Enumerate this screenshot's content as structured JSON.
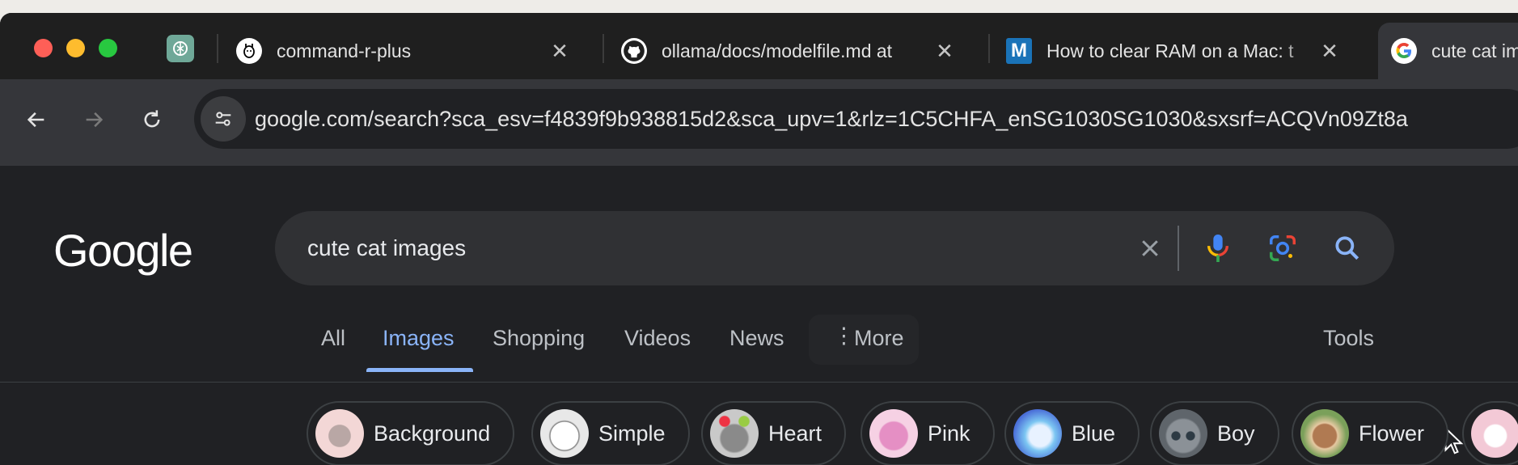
{
  "tabs": [
    {
      "title": "command-r-plus",
      "icon": "llama-icon"
    },
    {
      "title": "ollama/docs/modelfile.md at",
      "icon": "github-icon"
    },
    {
      "title": "How to clear RAM on a Mac: t",
      "icon": "m-icon"
    },
    {
      "title": "cute cat ima",
      "icon": "google-icon",
      "active": true
    }
  ],
  "toolbar": {
    "url": "google.com/search?sca_esv=f4839f9b938815d2&sca_upv=1&rlz=1C5CHFA_enSG1030SG1030&sxsrf=ACQVn09Zt8a"
  },
  "google": {
    "logo": "Google",
    "query": "cute cat images"
  },
  "nav": {
    "all": "All",
    "images": "Images",
    "shopping": "Shopping",
    "videos": "Videos",
    "news": "News",
    "more": "More",
    "tools": "Tools"
  },
  "chips": [
    {
      "label": "Background"
    },
    {
      "label": "Simple"
    },
    {
      "label": "Heart"
    },
    {
      "label": "Pink"
    },
    {
      "label": "Blue"
    },
    {
      "label": "Boy"
    },
    {
      "label": "Flower"
    }
  ],
  "colors": {
    "accent": "#8ab4f8",
    "page_bg": "#202124",
    "searchbox_bg": "#303134"
  }
}
